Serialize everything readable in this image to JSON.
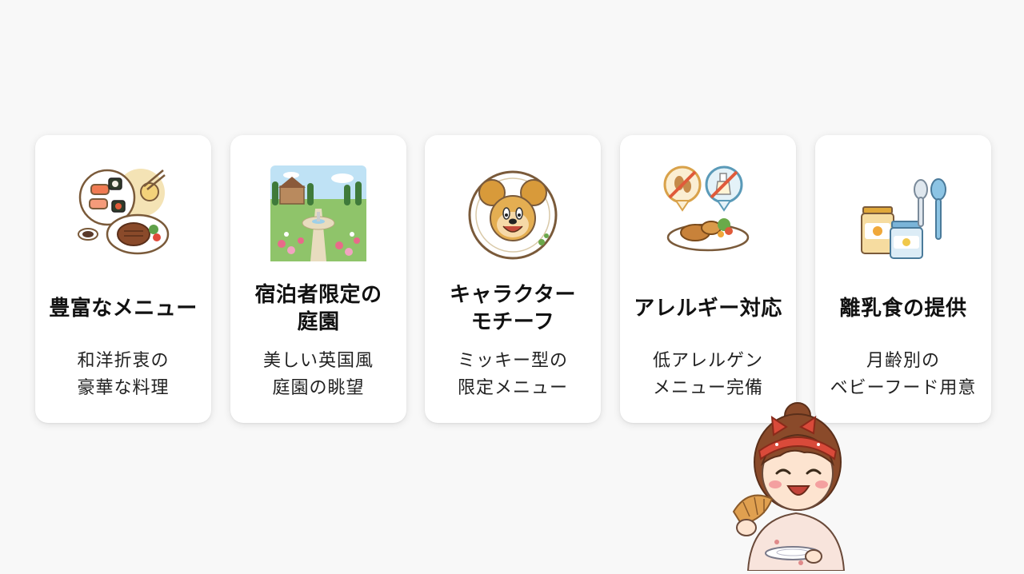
{
  "cards": [
    {
      "title": "豊富なメニュー",
      "desc": "和洋折衷の\n豪華な料理",
      "icon": "sushi-steak-icon"
    },
    {
      "title": "宿泊者限定の\n庭園",
      "desc": "美しい英国風\n庭園の眺望",
      "icon": "garden-icon"
    },
    {
      "title": "キャラクター\nモチーフ",
      "desc": "ミッキー型の\n限定メニュー",
      "icon": "mickey-waffle-icon"
    },
    {
      "title": "アレルギー対応",
      "desc": "低アレルゲン\nメニュー完備",
      "icon": "allergy-icon"
    },
    {
      "title": "離乳食の提供",
      "desc": "月齢別の\nベビーフード用意",
      "icon": "baby-food-icon"
    }
  ],
  "colors": {
    "background": "#f8f8f8",
    "card": "#ffffff",
    "accent": "#d94a3a"
  }
}
